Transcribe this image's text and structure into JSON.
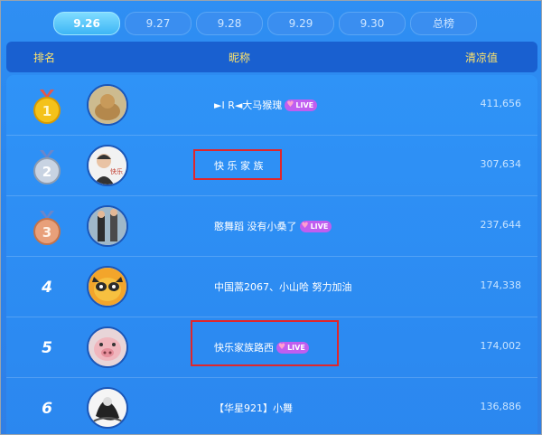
{
  "tabs": [
    {
      "label": "9.26",
      "active": true
    },
    {
      "label": "9.27",
      "active": false
    },
    {
      "label": "9.28",
      "active": false
    },
    {
      "label": "9.29",
      "active": false
    },
    {
      "label": "9.30",
      "active": false
    },
    {
      "label": "总榜",
      "active": false
    }
  ],
  "header": {
    "rank": "排名",
    "nickname": "昵称",
    "score": "清凉值"
  },
  "rows": [
    {
      "rank": "1",
      "medal": "gold",
      "name": "►I R◄大马猴瑰",
      "live": true,
      "score": "411,656"
    },
    {
      "rank": "2",
      "medal": "silver",
      "name": "快 乐 家 族",
      "live": false,
      "score": "307,634"
    },
    {
      "rank": "3",
      "medal": "bronze",
      "name": "憨舞蹈 没有小桑了",
      "live": true,
      "score": "237,644"
    },
    {
      "rank": "4",
      "medal": "",
      "name": "中国蒿2067、小山哈 努力加油",
      "live": false,
      "score": "174,338"
    },
    {
      "rank": "5",
      "medal": "",
      "name": "快乐家族路西",
      "live": true,
      "score": "174,002"
    },
    {
      "rank": "6",
      "medal": "",
      "name": "【华星921】小舞",
      "live": false,
      "score": "136,886"
    }
  ],
  "live_label": "LIVE",
  "avatars": [
    "dog-avatar",
    "person-avatar",
    "dancer-avatar",
    "raccoon-avatar",
    "pig-avatar",
    "ink-avatar"
  ],
  "avatar_texts": {
    "r2": "快乐"
  },
  "colors": {
    "accent": "#2f8ff3",
    "header": "#1960d0",
    "highlight": "#e0262b",
    "live": "#c05ef0"
  }
}
